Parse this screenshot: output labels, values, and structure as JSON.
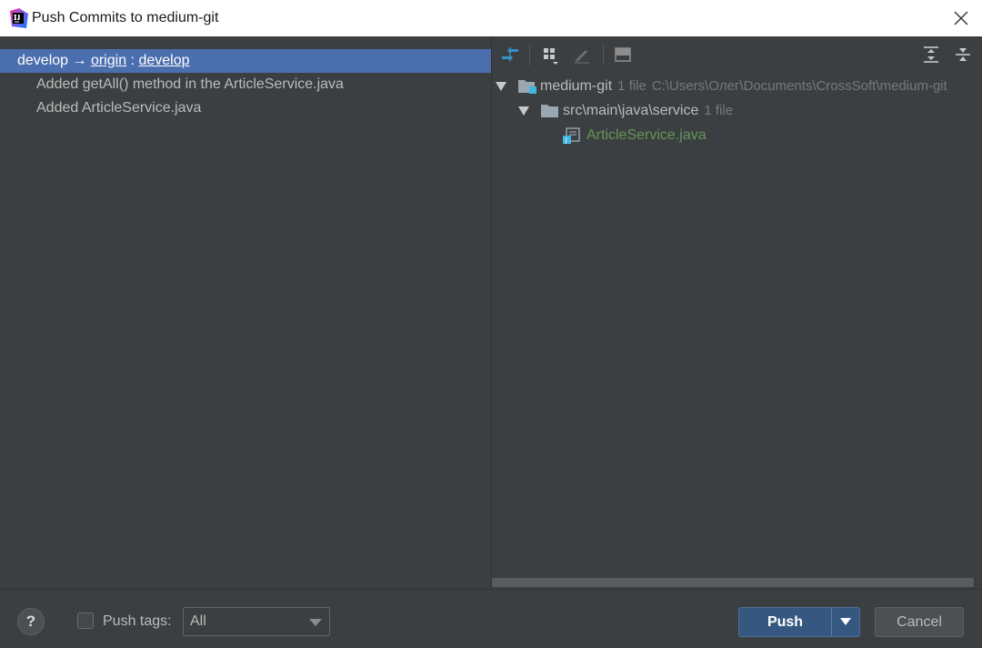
{
  "window": {
    "title": "Push Commits to medium-git"
  },
  "branch": {
    "local": "develop",
    "arrow": "→",
    "remote": "origin",
    "separator": ":",
    "remote_branch": "develop"
  },
  "commits": [
    {
      "message": "Added getAll() method in the ArticleService.java"
    },
    {
      "message": "Added ArticleService.java"
    }
  ],
  "tree": {
    "root": {
      "name": "medium-git",
      "count": "1 file",
      "path": "C:\\Users\\Олег\\Documents\\CrossSoft\\medium-git"
    },
    "folder": {
      "name": "src\\main\\java\\service",
      "count": "1 file"
    },
    "file": {
      "name": "ArticleService.java"
    }
  },
  "toolbar": {
    "icons": [
      "show-diff-icon",
      "group-by-icon",
      "edit-source-icon",
      "preview-icon",
      "expand-all-icon",
      "collapse-all-icon"
    ]
  },
  "footer": {
    "help_label": "?",
    "push_tags_label": "Push tags:",
    "tags_filter": {
      "selected": "All"
    },
    "push_label": "Push",
    "cancel_label": "Cancel"
  },
  "colors": {
    "background": "#3c3f41",
    "selection": "#4b6eaf",
    "primary_button": "#365880",
    "java_file": "#629755",
    "titlebar": "#ffffff"
  }
}
